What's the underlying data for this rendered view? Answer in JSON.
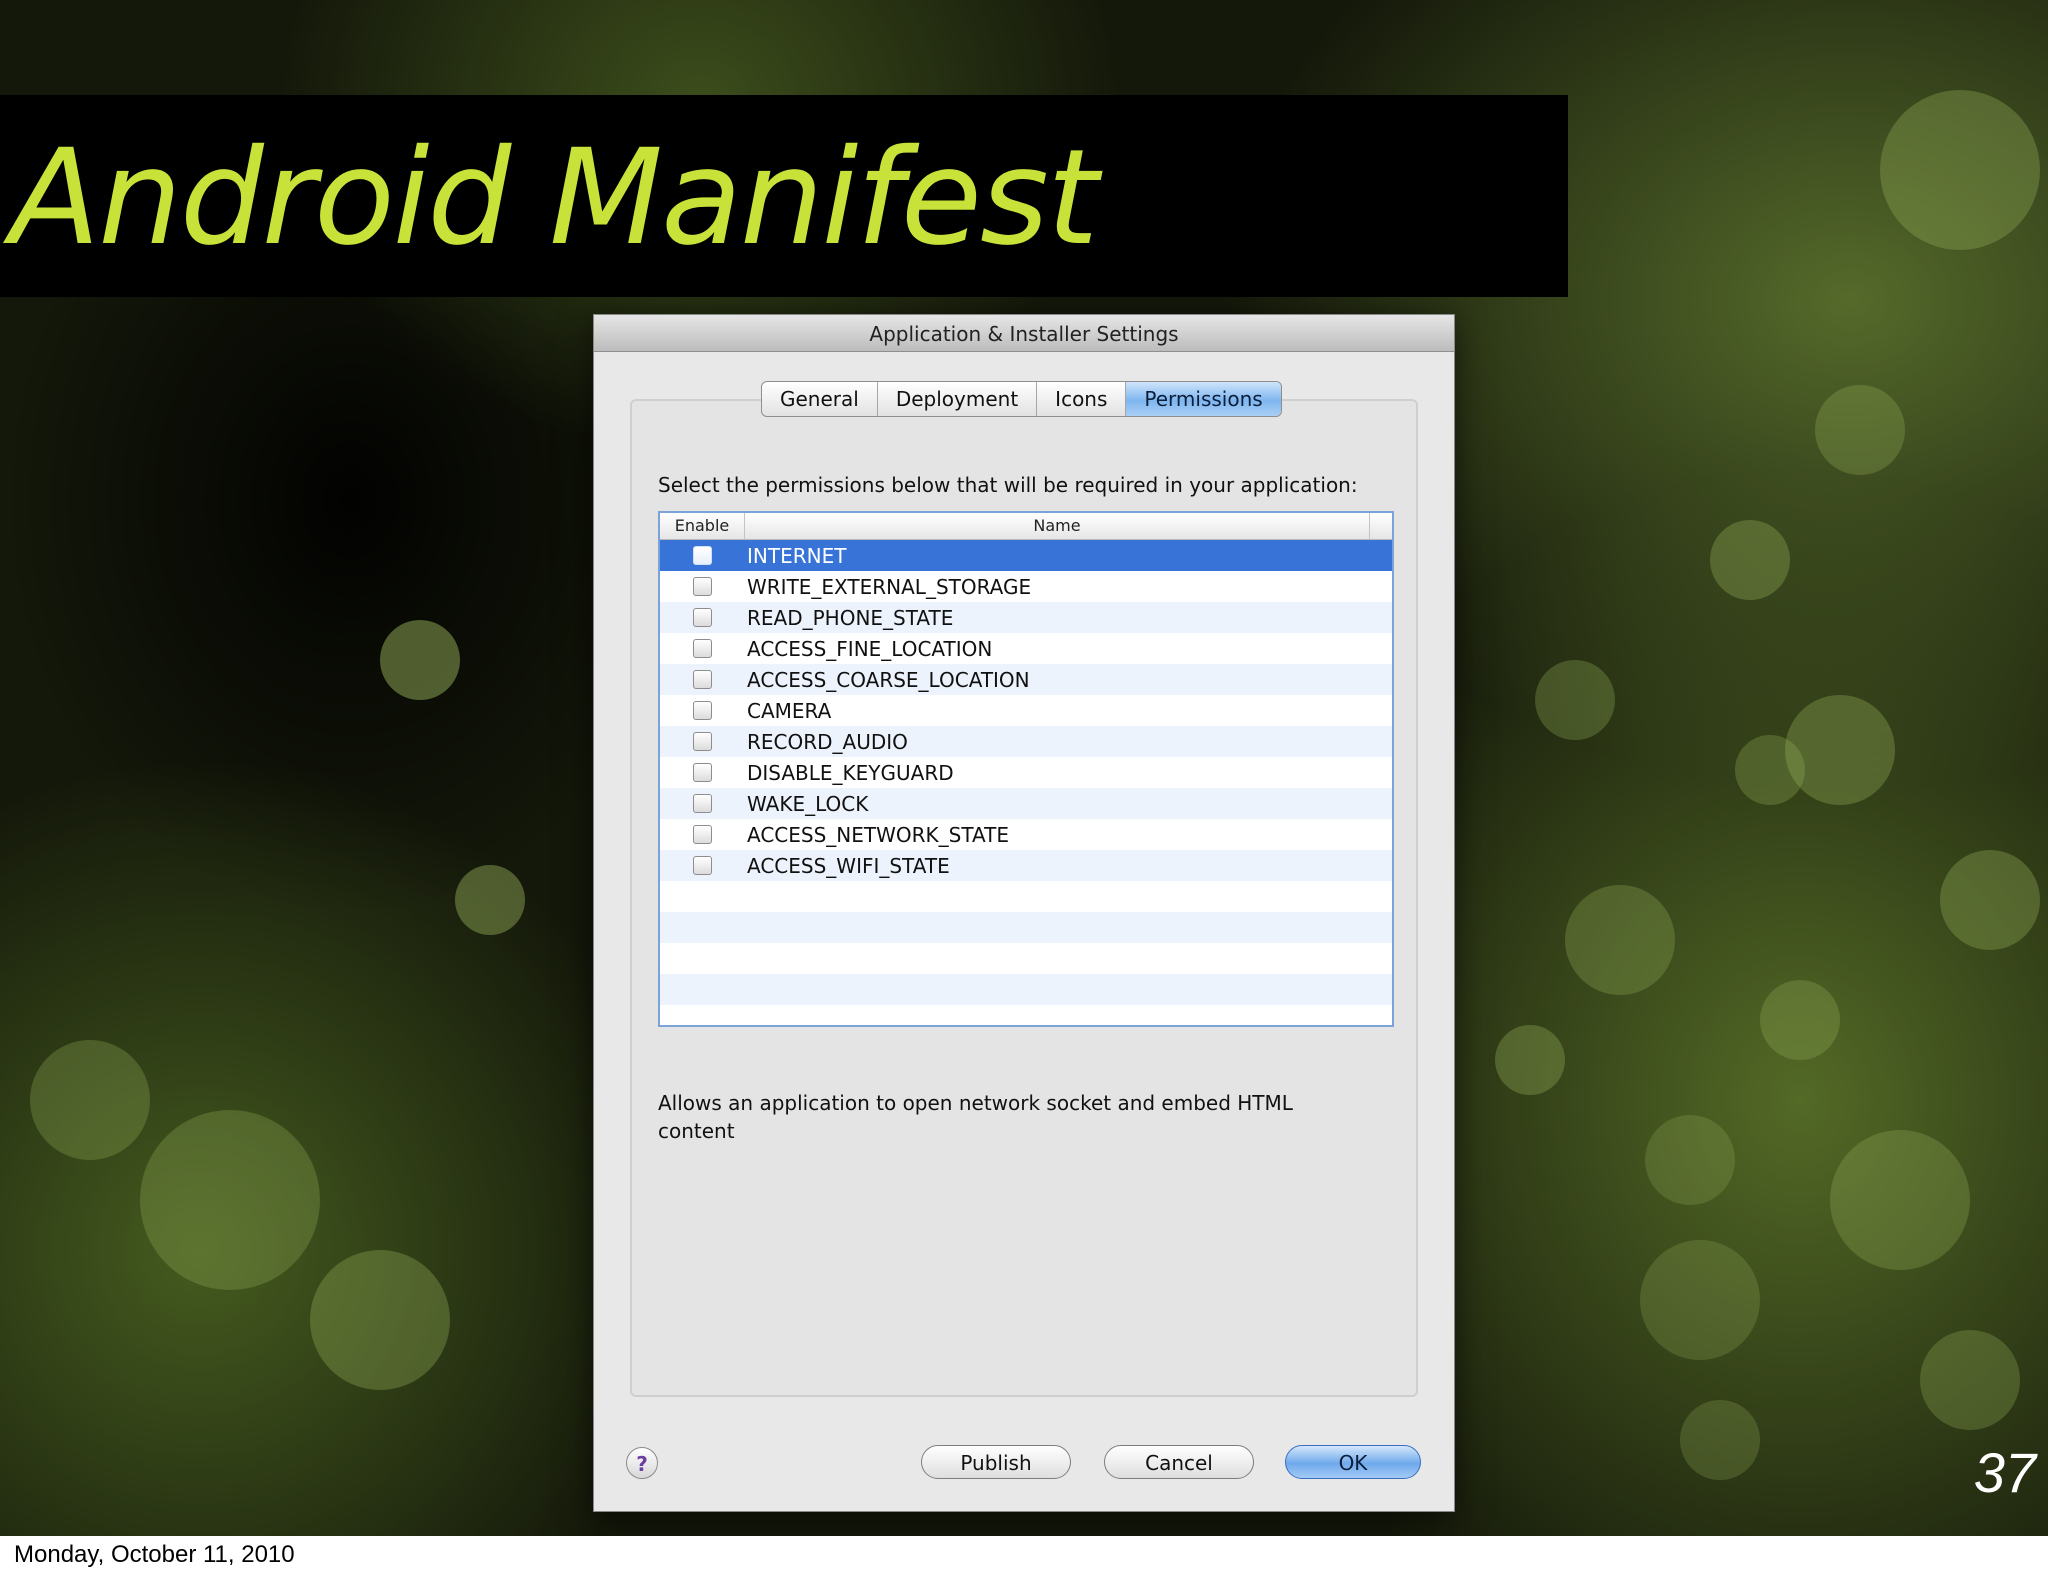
{
  "slide": {
    "title": "Android Manifest",
    "number": "37",
    "footer_date": "Monday, October 11, 2010",
    "title_color": "#c9e23a"
  },
  "dialog": {
    "title": "Application & Installer Settings",
    "tabs": [
      {
        "label": "General",
        "active": false
      },
      {
        "label": "Deployment",
        "active": false
      },
      {
        "label": "Icons",
        "active": false
      },
      {
        "label": "Permissions",
        "active": true
      }
    ],
    "instruction": "Select the permissions below that will be required in your application:",
    "table": {
      "columns": [
        "Enable",
        "Name"
      ],
      "selected_index": 0,
      "rows": [
        {
          "name": "INTERNET",
          "enabled": false
        },
        {
          "name": "WRITE_EXTERNAL_STORAGE",
          "enabled": false
        },
        {
          "name": "READ_PHONE_STATE",
          "enabled": false
        },
        {
          "name": "ACCESS_FINE_LOCATION",
          "enabled": false
        },
        {
          "name": "ACCESS_COARSE_LOCATION",
          "enabled": false
        },
        {
          "name": "CAMERA",
          "enabled": false
        },
        {
          "name": "RECORD_AUDIO",
          "enabled": false
        },
        {
          "name": "DISABLE_KEYGUARD",
          "enabled": false
        },
        {
          "name": "WAKE_LOCK",
          "enabled": false
        },
        {
          "name": "ACCESS_NETWORK_STATE",
          "enabled": false
        },
        {
          "name": "ACCESS_WIFI_STATE",
          "enabled": false
        }
      ]
    },
    "description": "Allows an application to open network socket and embed HTML content",
    "buttons": {
      "help_icon": "question-mark",
      "publish": "Publish",
      "cancel": "Cancel",
      "ok": "OK"
    },
    "accent_color": "#3874d8"
  }
}
